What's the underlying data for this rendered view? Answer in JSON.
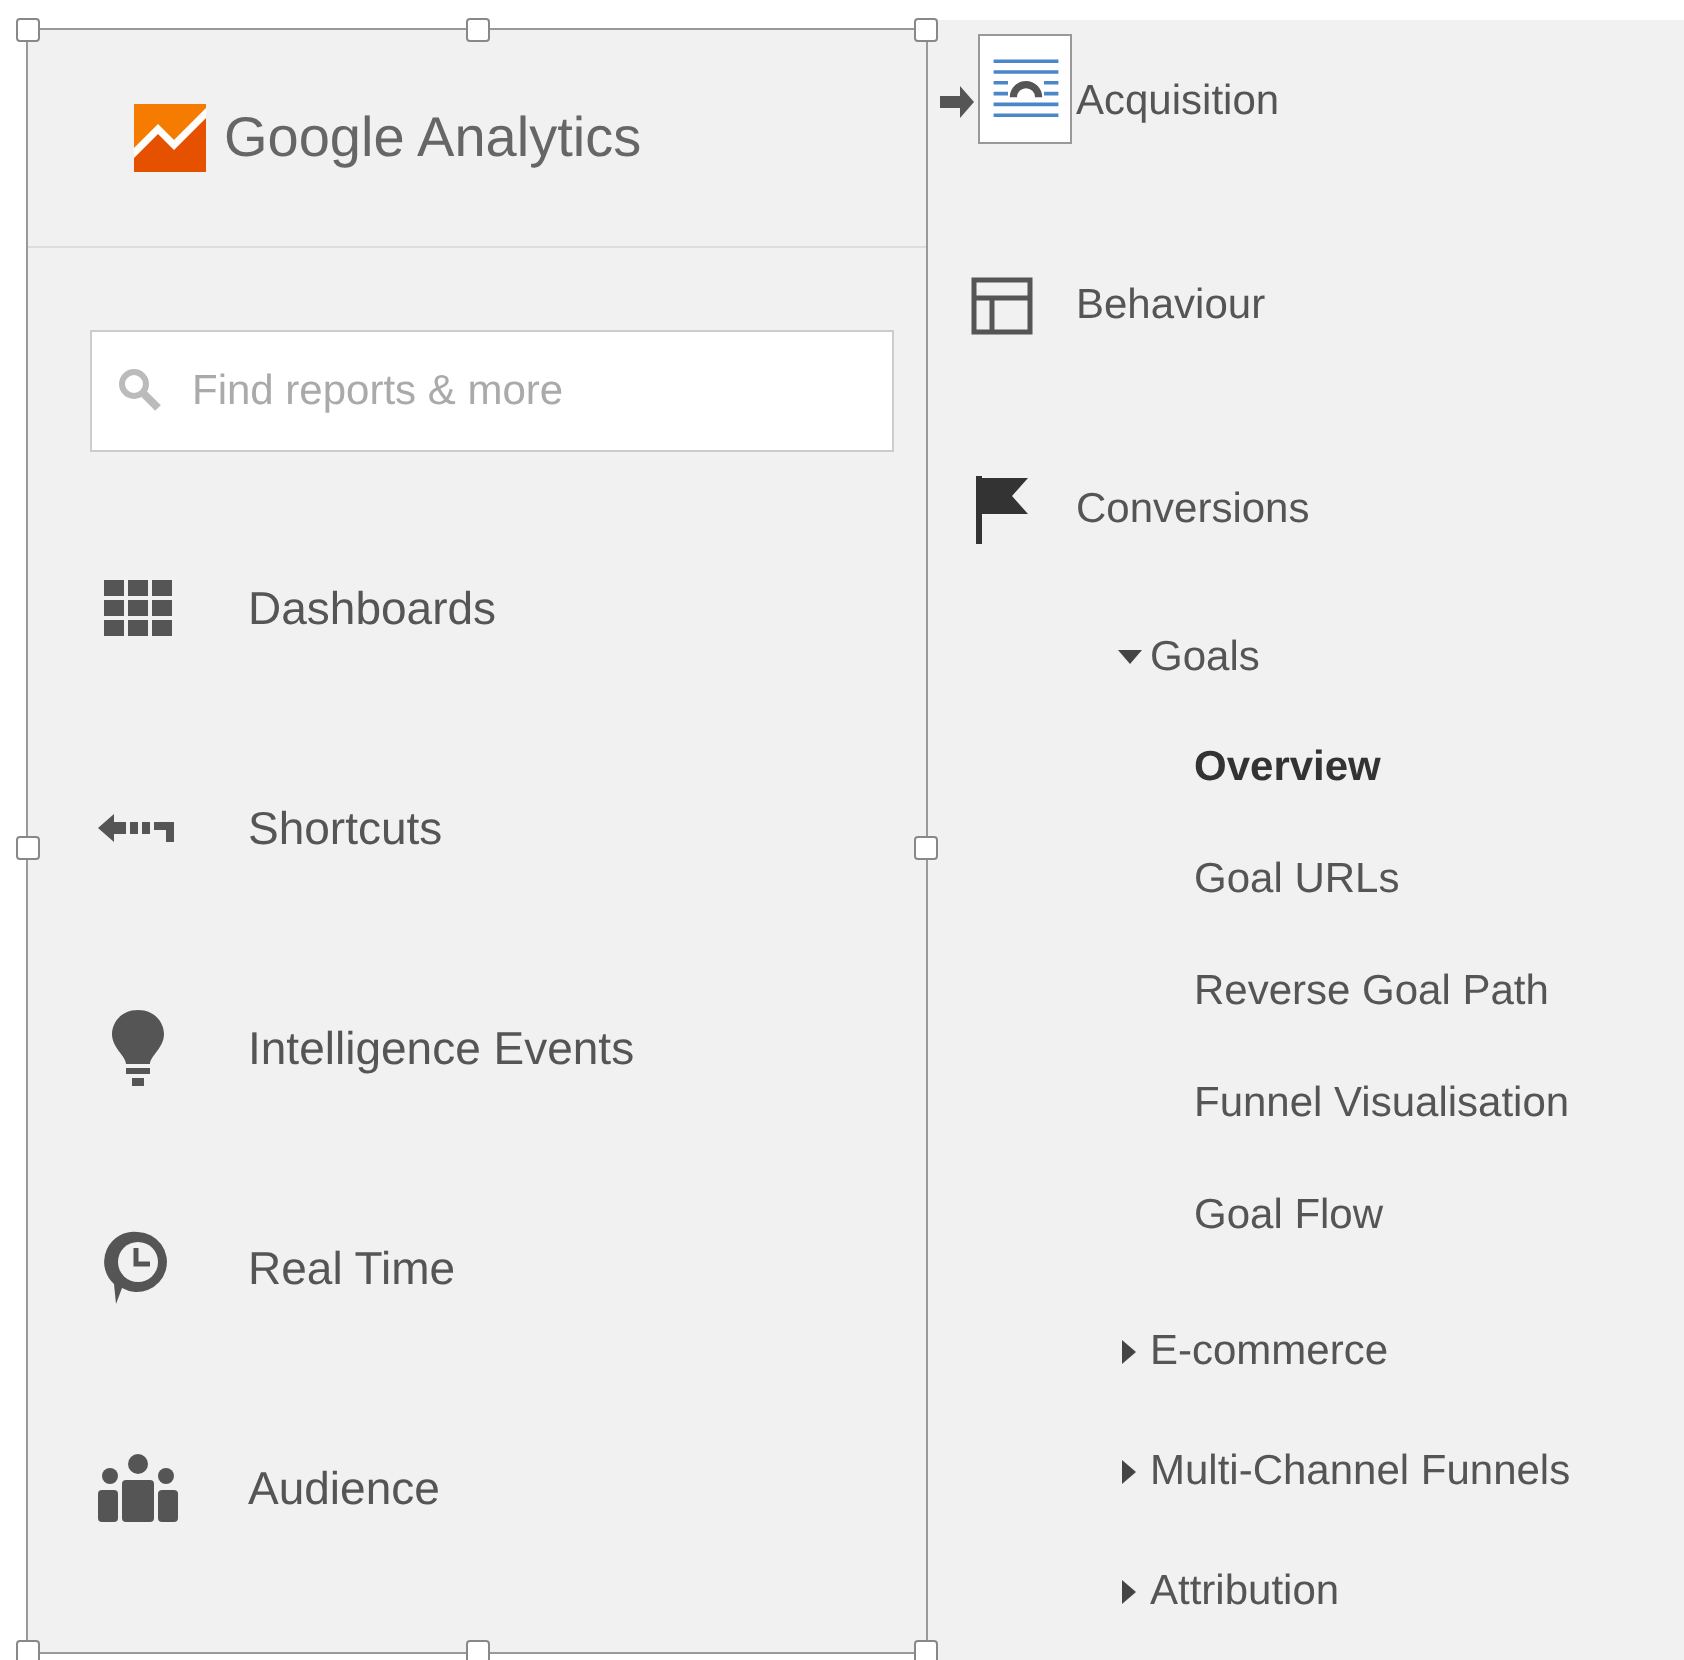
{
  "logo": {
    "text": "Google Analytics"
  },
  "search": {
    "placeholder": "Find reports & more"
  },
  "nav_items": [
    {
      "label": "Dashboards",
      "kind": "grid"
    },
    {
      "label": "Shortcuts",
      "kind": "shortcut"
    },
    {
      "label": "Intelligence Events",
      "kind": "bulb"
    },
    {
      "label": "Real Time",
      "kind": "clock"
    },
    {
      "label": "Audience",
      "kind": "people"
    }
  ],
  "report_sections": [
    {
      "label": "Acquisition",
      "kind": "arrow"
    },
    {
      "label": "Behaviour",
      "kind": "layout"
    },
    {
      "label": "Conversions",
      "kind": "flag"
    }
  ],
  "conversion_groups": [
    {
      "label": "Goals",
      "expanded": true,
      "children": [
        {
          "label": "Overview",
          "selected": true
        },
        {
          "label": "Goal URLs",
          "selected": false
        },
        {
          "label": "Reverse Goal Path",
          "selected": false
        },
        {
          "label": "Funnel Visualisation",
          "selected": false
        },
        {
          "label": "Goal Flow",
          "selected": false
        }
      ]
    },
    {
      "label": "E-commerce",
      "expanded": false
    },
    {
      "label": "Multi-Channel Funnels",
      "expanded": false
    },
    {
      "label": "Attribution",
      "expanded": false
    }
  ]
}
